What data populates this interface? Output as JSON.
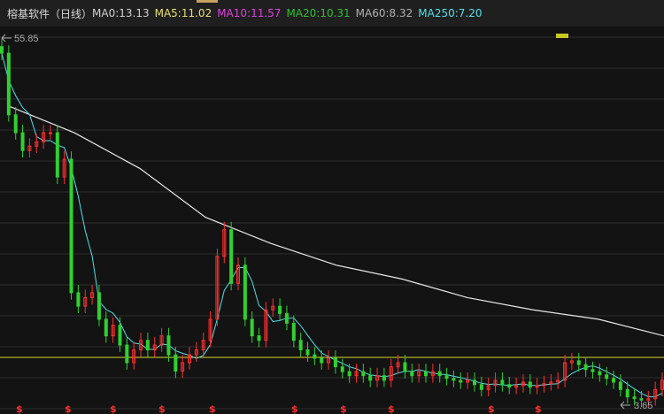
{
  "header": {
    "title": "榕基软件（日线）",
    "ma": [
      {
        "label": "MA0:13.13",
        "color": "#cfcfcf"
      },
      {
        "label": "MA5:11.02",
        "color": "#e8e070"
      },
      {
        "label": "MA10:11.57",
        "color": "#e040e0"
      },
      {
        "label": "MA20:10.31",
        "color": "#30c030"
      },
      {
        "label": "MA60:8.32",
        "color": "#b0b0b0"
      },
      {
        "label": "MA250:7.20",
        "color": "#50e0e8"
      }
    ]
  },
  "chart_data": {
    "type": "candlestick",
    "scale": "log",
    "ylim": [
      3.65,
      55.85
    ],
    "max_label": "55.85",
    "min_label": "3.65",
    "grid": true,
    "reference_line": {
      "value": 5.2,
      "color": "#d8d830"
    },
    "colors": {
      "up": "#ff3030",
      "down": "#30d030",
      "ma20": "#50e0e8",
      "ma250": "#e8e8e8",
      "marker": "#ff3030"
    },
    "closes": [
      49.6,
      31.4,
      27.5,
      24.1,
      24.9,
      25.7,
      27.5,
      27.5,
      19.8,
      22.6,
      8.4,
      7.6,
      8.1,
      8.4,
      6.9,
      6.1,
      6.6,
      5.7,
      5.0,
      5.5,
      5.9,
      5.5,
      5.7,
      6.1,
      5.3,
      4.7,
      5.0,
      5.3,
      5.5,
      5.9,
      6.9,
      11.0,
      13.4,
      9.0,
      10.3,
      6.9,
      6.1,
      5.9,
      7.4,
      7.6,
      7.2,
      6.7,
      5.9,
      5.5,
      5.3,
      5.17,
      5.0,
      5.17,
      4.85,
      4.68,
      4.54,
      4.68,
      4.54,
      4.39,
      4.54,
      4.39,
      4.85,
      5.0,
      4.68,
      4.54,
      4.68,
      4.54,
      4.68,
      4.54,
      4.45,
      4.39,
      4.33,
      4.39,
      4.25,
      4.1,
      4.22,
      4.39,
      4.25,
      4.17,
      4.22,
      4.33,
      4.17,
      4.22,
      4.28,
      4.33,
      4.39,
      5.0,
      5.07,
      4.93,
      4.75,
      4.68,
      4.57,
      4.45,
      4.33,
      4.1,
      3.88,
      3.83,
      3.79,
      3.83,
      4.1,
      4.39
    ],
    "ma250": [
      33.5,
      27.5,
      21.1,
      14.7,
      12.1,
      10.3,
      9.3,
      8.1,
      7.4,
      6.9,
      6.1
    ],
    "markers": [
      "$",
      "$",
      "$",
      "$",
      "$",
      "$",
      "$",
      "$",
      "$",
      "$"
    ]
  }
}
